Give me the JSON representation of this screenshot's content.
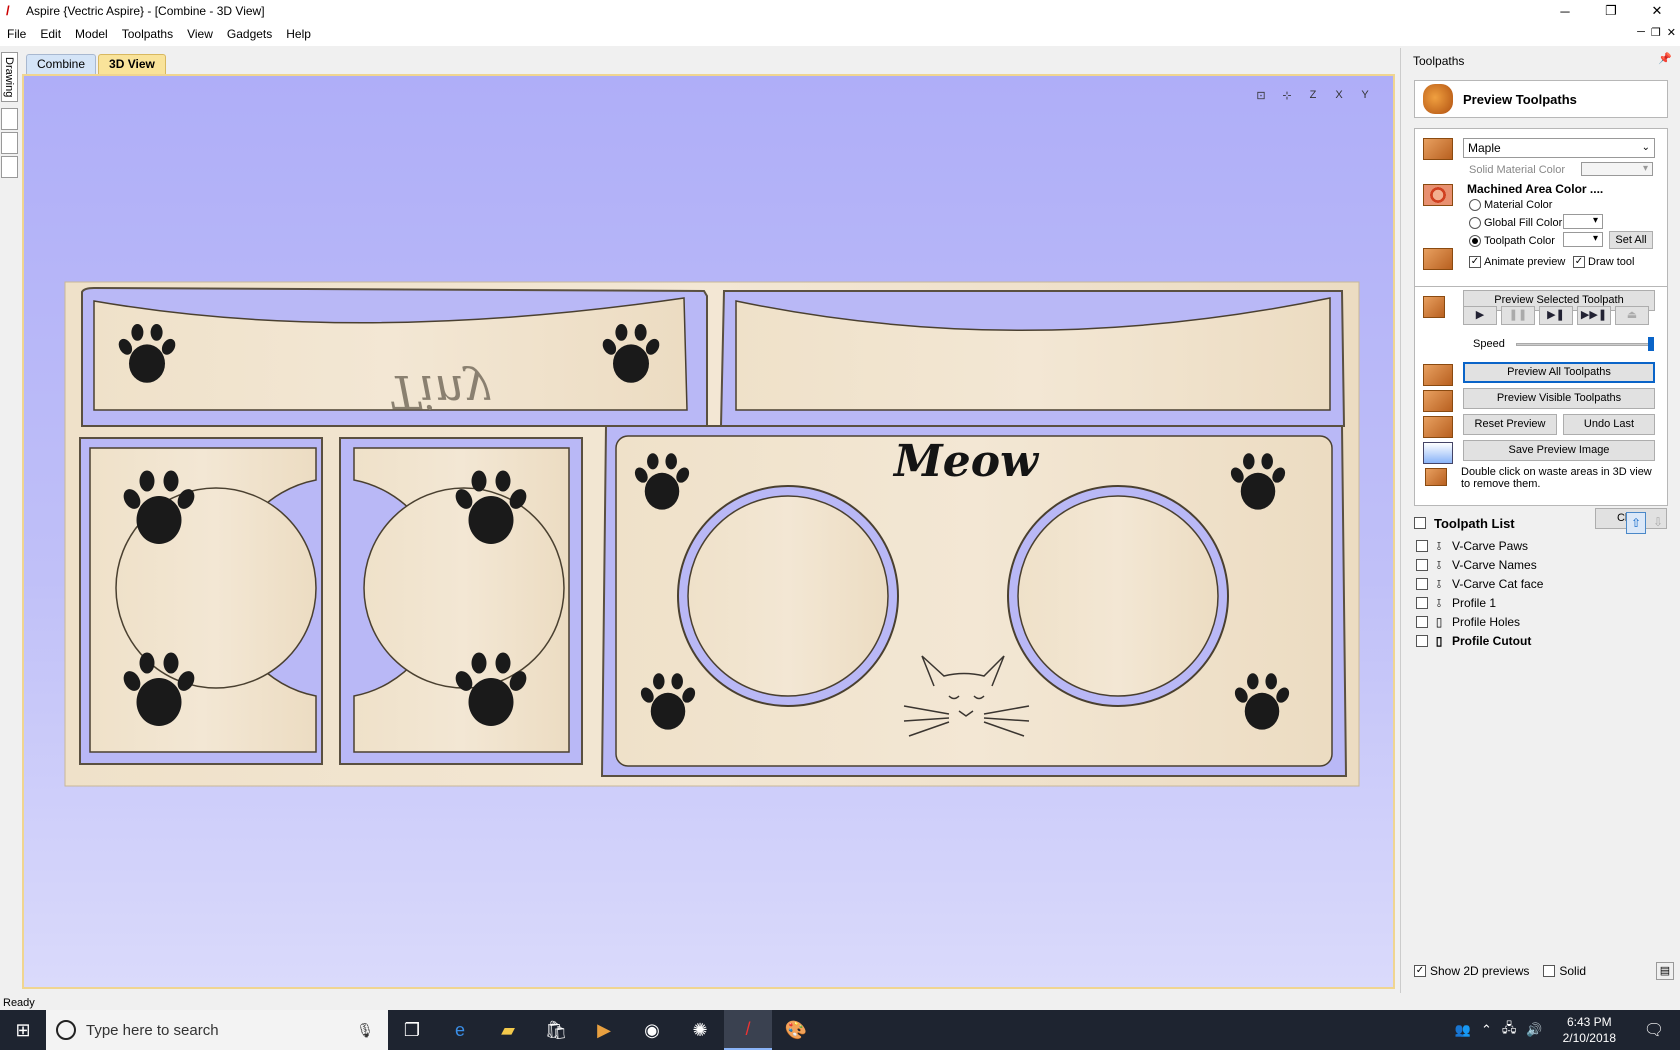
{
  "window": {
    "title": "Aspire {Vectric Aspire} - [Combine - 3D View]",
    "minimize": "─",
    "restore": "❐",
    "close": "✕"
  },
  "menu": [
    "File",
    "Edit",
    "Model",
    "Toolpaths",
    "View",
    "Gadgets",
    "Help"
  ],
  "left_tabs": [
    "Drawing"
  ],
  "doc_tabs": [
    {
      "label": "Combine",
      "active": false
    },
    {
      "label": "3D View",
      "active": true
    }
  ],
  "view_icons": [
    "⊡",
    "⊹",
    "Z",
    "X",
    "Y"
  ],
  "model": {
    "name_text": "Tiny",
    "meow_text": "Meow"
  },
  "status": "Ready",
  "taskbar": {
    "search_placeholder": "Type here to search",
    "time": "6:43 PM",
    "date": "2/10/2018"
  },
  "panel": {
    "title": "Toolpaths",
    "header": "Preview Toolpaths",
    "material": "Maple",
    "solid_material_color": "Solid Material Color",
    "machined_area_color": "Machined Area Color ....",
    "radio_material": "Material Color",
    "radio_global": "Global Fill Color",
    "radio_toolpath": "Toolpath Color",
    "set_all": "Set All",
    "animate_preview": "Animate preview",
    "draw_tool": "Draw tool",
    "preview_selected": "Preview Selected Toolpath",
    "speed": "Speed",
    "speed_level": 1.0,
    "preview_all": "Preview All Toolpaths",
    "preview_visible": "Preview Visible Toolpaths",
    "reset_preview": "Reset Preview",
    "undo_last": "Undo Last",
    "save_preview_image": "Save Preview Image",
    "hint": "Double click on waste areas in 3D view to remove them.",
    "close": "Close",
    "toolpath_list_title": "Toolpath List",
    "toolpaths": [
      {
        "name": "V-Carve Paws",
        "bold": false
      },
      {
        "name": "V-Carve Names",
        "bold": false
      },
      {
        "name": "V-Carve Cat face",
        "bold": false
      },
      {
        "name": "Profile 1",
        "bold": false
      },
      {
        "name": "Profile Holes",
        "bold": false
      },
      {
        "name": "Profile Cutout",
        "bold": true
      }
    ],
    "show_2d_previews": "Show 2D previews",
    "solid": "Solid"
  },
  "colors": {
    "viewport_top": "#afaef8",
    "wood": "#efe2cc",
    "active_tab": "#f9e39a",
    "accent": "#0a64c8"
  }
}
